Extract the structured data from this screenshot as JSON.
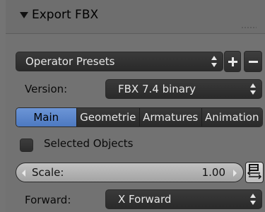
{
  "panel": {
    "title": "Export FBX"
  },
  "presets": {
    "label": "Operator Presets"
  },
  "version": {
    "label": "Version:",
    "value": "FBX 7.4 binary"
  },
  "tabs": [
    {
      "label": "Main",
      "active": true
    },
    {
      "label": "Geometrie",
      "active": false
    },
    {
      "label": "Armatures",
      "active": false
    },
    {
      "label": "Animation",
      "active": false
    }
  ],
  "selected_objects": {
    "label": "Selected Objects",
    "checked": false
  },
  "scale": {
    "label": "Scale:",
    "value": "1.00"
  },
  "forward": {
    "label": "Forward:",
    "value": "X Forward"
  },
  "colors": {
    "panel_bg": "#727272",
    "active_tab": "#5a86cf",
    "widget_dark": "#2f2f2f"
  },
  "icons": [
    "collapse-triangle-icon",
    "drag-grip-icon",
    "up-down-arrows-icon",
    "plus-icon",
    "minus-icon",
    "flip-axes-icon"
  ]
}
